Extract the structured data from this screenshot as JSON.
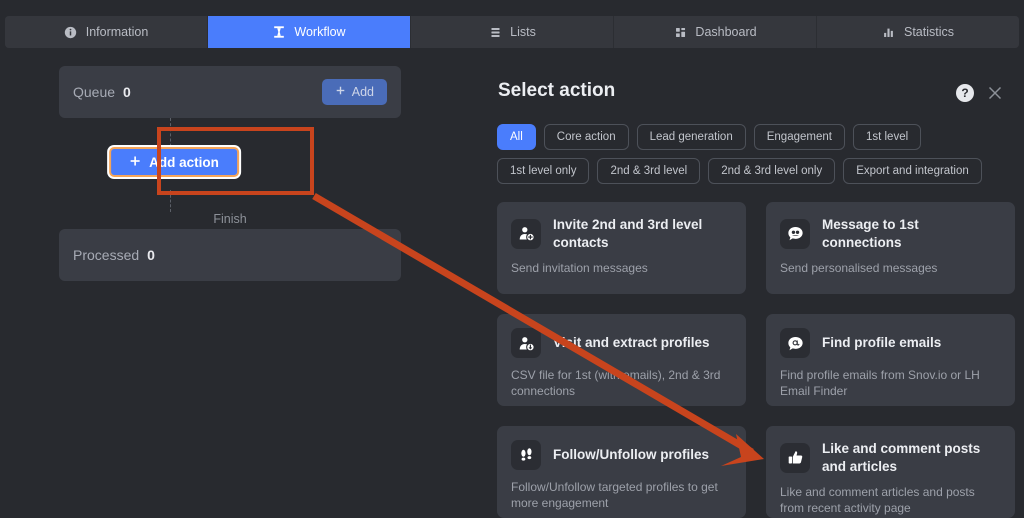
{
  "tabs": [
    {
      "label": "Information",
      "icon": "info-icon",
      "active": false
    },
    {
      "label": "Workflow",
      "icon": "workflow-icon",
      "active": true
    },
    {
      "label": "Lists",
      "icon": "lists-icon",
      "active": false
    },
    {
      "label": "Dashboard",
      "icon": "dashboard-icon",
      "active": false
    },
    {
      "label": "Statistics",
      "icon": "statistics-icon",
      "active": false
    }
  ],
  "workflow": {
    "queue_label": "Queue",
    "queue_count": "0",
    "add_label": "Add",
    "add_action_label": "Add action",
    "finish_label": "Finish",
    "processed_label": "Processed",
    "processed_count": "0"
  },
  "panel": {
    "title": "Select action",
    "help_icon": "question-mark-icon",
    "close_icon": "close-icon",
    "chips": [
      {
        "label": "All",
        "active": true
      },
      {
        "label": "Core action",
        "active": false
      },
      {
        "label": "Lead generation",
        "active": false
      },
      {
        "label": "Engagement",
        "active": false
      },
      {
        "label": "1st level",
        "active": false
      },
      {
        "label": "1st level only",
        "active": false
      },
      {
        "label": "2nd & 3rd level",
        "active": false
      },
      {
        "label": "2nd & 3rd level only",
        "active": false
      },
      {
        "label": "Export and integration",
        "active": false
      }
    ],
    "cards": [
      {
        "title": "Invite 2nd and 3rd level contacts",
        "desc": "Send invitation messages",
        "icon": "person-add-icon"
      },
      {
        "title": "Message to 1st connections",
        "desc": "Send personalised messages",
        "icon": "message-bubble-icon"
      },
      {
        "title": "Visit and extract profiles",
        "desc": "CSV file for 1st (with emails), 2nd & 3rd connections",
        "icon": "person-download-icon"
      },
      {
        "title": "Find profile emails",
        "desc": "Find profile emails from Snov.io or LH Email Finder",
        "icon": "at-bubble-icon"
      },
      {
        "title": "Follow/Unfollow profiles",
        "desc": "Follow/Unfollow targeted profiles to get more engagement",
        "icon": "footprints-icon"
      },
      {
        "title": "Like and comment posts and articles",
        "desc": "Like and comment articles and posts from recent activity page",
        "icon": "thumbs-up-icon"
      }
    ]
  },
  "annotation": {
    "color": "#c8441d",
    "highlight_color": "#f5a55a"
  },
  "colors": {
    "accent": "#4a7dfc",
    "canvas": "#282a2f",
    "card": "#3a3d45"
  }
}
